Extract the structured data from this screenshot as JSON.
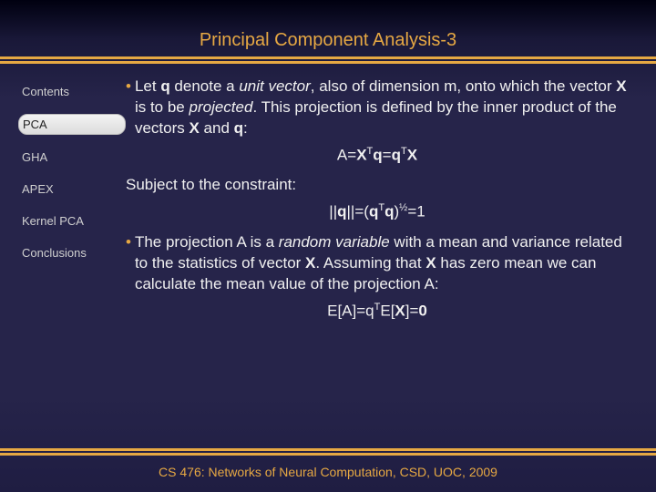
{
  "title": "Principal Component Analysis-3",
  "sidebar": {
    "items": [
      {
        "label": "Contents",
        "active": false
      },
      {
        "label": "PCA",
        "active": true
      },
      {
        "label": "GHA",
        "active": false
      },
      {
        "label": "APEX",
        "active": false
      },
      {
        "label": "Kernel PCA",
        "active": false
      },
      {
        "label": "Conclusions",
        "active": false
      }
    ]
  },
  "body": {
    "p1_pre": "Let ",
    "p1_q": "q",
    "p1_mid1": " denote a ",
    "p1_uv": "unit vector",
    "p1_mid2": ", also of dimension m, onto which the vector ",
    "p1_X": "X",
    "p1_mid3": " is to be ",
    "p1_proj": "projected",
    "p1_mid4": ". This projection is defined by the inner product of the vectors ",
    "p1_X2": "X",
    "p1_and": " and ",
    "p1_q2": "q",
    "p1_end": ":",
    "eq1_html": "A=<b>X</b><span class='sup'>T</span><b>q</b>=<b>q</b><span class='sup'>T</span><b>X</b>",
    "subject": "Subject to the constraint:",
    "eq2_html": "||<b>q</b>||=(<b>q</b><span class='sup'>T</span><b>q</b>)<span class='sup'>½</span>=1",
    "p2_pre": "The projection A is a ",
    "p2_rv": "random variable",
    "p2_mid1": " with a mean and variance related to the statistics of vector ",
    "p2_X": "X",
    "p2_mid2": ". Assuming that ",
    "p2_X2": "X",
    "p2_mid3": " has zero mean we can calculate the mean value of the projection A:",
    "eq3_html": "E[A]=q<span class='sup'>T</span>E[<b>X</b>]=<b>0</b>"
  },
  "footer": "CS 476: Networks of Neural Computation, CSD, UOC, 2009"
}
